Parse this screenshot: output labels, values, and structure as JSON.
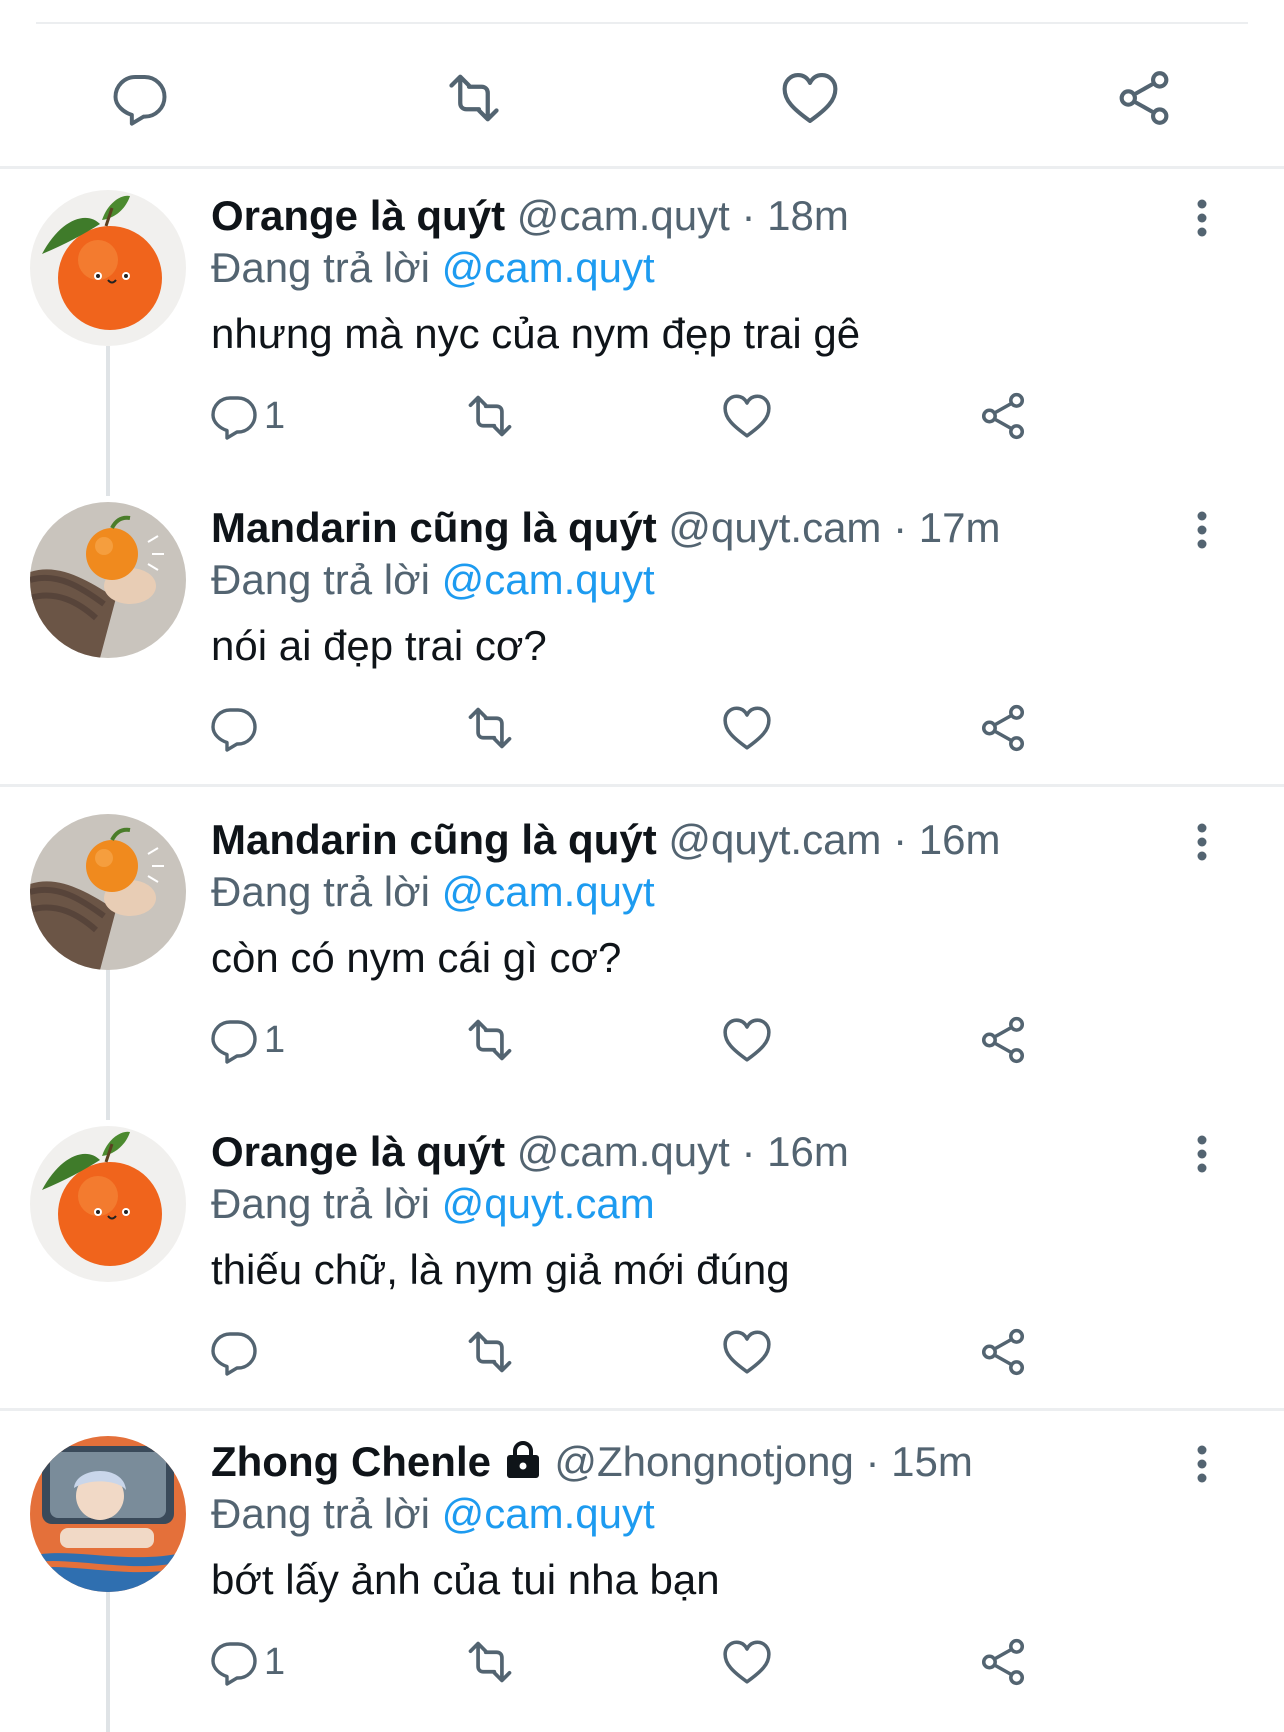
{
  "top_actions": {
    "reply": "reply-icon",
    "retweet": "retweet-icon",
    "like": "heart-icon",
    "share": "share-icon"
  },
  "tweets": [
    {
      "name": "Orange là quýt",
      "handle": "@cam.quyt",
      "time": "· 18m",
      "reply_prefix": "Đang trả lời",
      "reply_to": "@cam.quyt",
      "text": "nhưng mà nyc của nym đẹp trai gê",
      "reply_count": "1"
    },
    {
      "name": "Mandarin cũng là quýt",
      "handle": "@quyt.cam",
      "time": "· 17m",
      "reply_prefix": "Đang trả lời",
      "reply_to": "@cam.quyt",
      "text": "nói ai đẹp trai cơ?",
      "reply_count": ""
    },
    {
      "name": "Mandarin cũng là quýt",
      "handle": "@quyt.cam",
      "time": "· 16m",
      "reply_prefix": "Đang trả lời",
      "reply_to": "@cam.quyt",
      "text": "còn có nym cái gì cơ?",
      "reply_count": "1"
    },
    {
      "name": "Orange là quýt",
      "handle": "@cam.quyt",
      "time": "· 16m",
      "reply_prefix": "Đang trả lời",
      "reply_to": "@quyt.cam",
      "text": "thiếu chữ, là nym giả mới đúng",
      "reply_count": ""
    },
    {
      "name": "Zhong Chenle",
      "handle": "@Zhongnotjong",
      "time": "· 15m",
      "reply_prefix": "Đang trả lời",
      "reply_to": "@cam.quyt",
      "text": "bớt lấy ảnh của tui nha bạn",
      "reply_count": "1"
    }
  ],
  "colors": {
    "text": "#0f1419",
    "secondary": "#536471",
    "link": "#1d9bf0",
    "divider": "#eceef0",
    "icon": "#536471"
  }
}
